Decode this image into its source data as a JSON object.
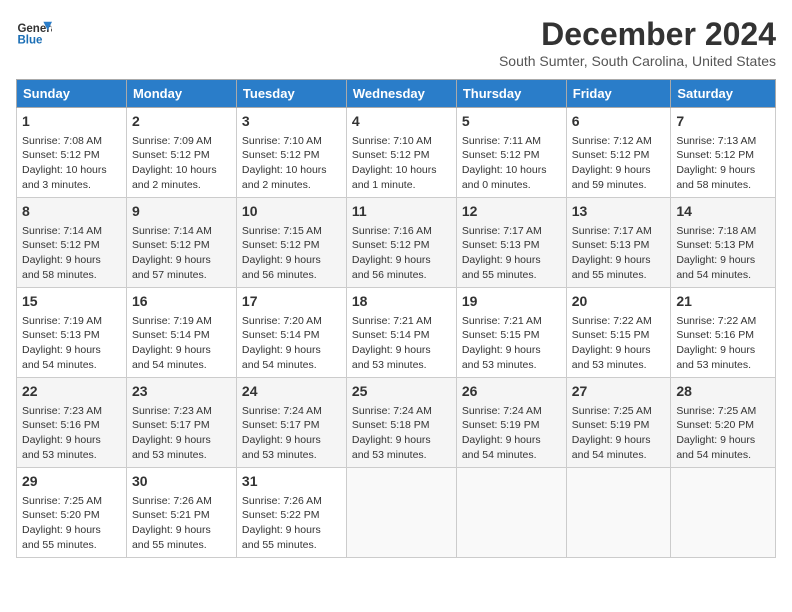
{
  "header": {
    "logo_line1": "General",
    "logo_line2": "Blue",
    "month_title": "December 2024",
    "location": "South Sumter, South Carolina, United States"
  },
  "days_of_week": [
    "Sunday",
    "Monday",
    "Tuesday",
    "Wednesday",
    "Thursday",
    "Friday",
    "Saturday"
  ],
  "weeks": [
    [
      {
        "day": "1",
        "lines": [
          "Sunrise: 7:08 AM",
          "Sunset: 5:12 PM",
          "Daylight: 10 hours",
          "and 3 minutes."
        ]
      },
      {
        "day": "2",
        "lines": [
          "Sunrise: 7:09 AM",
          "Sunset: 5:12 PM",
          "Daylight: 10 hours",
          "and 2 minutes."
        ]
      },
      {
        "day": "3",
        "lines": [
          "Sunrise: 7:10 AM",
          "Sunset: 5:12 PM",
          "Daylight: 10 hours",
          "and 2 minutes."
        ]
      },
      {
        "day": "4",
        "lines": [
          "Sunrise: 7:10 AM",
          "Sunset: 5:12 PM",
          "Daylight: 10 hours",
          "and 1 minute."
        ]
      },
      {
        "day": "5",
        "lines": [
          "Sunrise: 7:11 AM",
          "Sunset: 5:12 PM",
          "Daylight: 10 hours",
          "and 0 minutes."
        ]
      },
      {
        "day": "6",
        "lines": [
          "Sunrise: 7:12 AM",
          "Sunset: 5:12 PM",
          "Daylight: 9 hours",
          "and 59 minutes."
        ]
      },
      {
        "day": "7",
        "lines": [
          "Sunrise: 7:13 AM",
          "Sunset: 5:12 PM",
          "Daylight: 9 hours",
          "and 58 minutes."
        ]
      }
    ],
    [
      {
        "day": "8",
        "lines": [
          "Sunrise: 7:14 AM",
          "Sunset: 5:12 PM",
          "Daylight: 9 hours",
          "and 58 minutes."
        ]
      },
      {
        "day": "9",
        "lines": [
          "Sunrise: 7:14 AM",
          "Sunset: 5:12 PM",
          "Daylight: 9 hours",
          "and 57 minutes."
        ]
      },
      {
        "day": "10",
        "lines": [
          "Sunrise: 7:15 AM",
          "Sunset: 5:12 PM",
          "Daylight: 9 hours",
          "and 56 minutes."
        ]
      },
      {
        "day": "11",
        "lines": [
          "Sunrise: 7:16 AM",
          "Sunset: 5:12 PM",
          "Daylight: 9 hours",
          "and 56 minutes."
        ]
      },
      {
        "day": "12",
        "lines": [
          "Sunrise: 7:17 AM",
          "Sunset: 5:13 PM",
          "Daylight: 9 hours",
          "and 55 minutes."
        ]
      },
      {
        "day": "13",
        "lines": [
          "Sunrise: 7:17 AM",
          "Sunset: 5:13 PM",
          "Daylight: 9 hours",
          "and 55 minutes."
        ]
      },
      {
        "day": "14",
        "lines": [
          "Sunrise: 7:18 AM",
          "Sunset: 5:13 PM",
          "Daylight: 9 hours",
          "and 54 minutes."
        ]
      }
    ],
    [
      {
        "day": "15",
        "lines": [
          "Sunrise: 7:19 AM",
          "Sunset: 5:13 PM",
          "Daylight: 9 hours",
          "and 54 minutes."
        ]
      },
      {
        "day": "16",
        "lines": [
          "Sunrise: 7:19 AM",
          "Sunset: 5:14 PM",
          "Daylight: 9 hours",
          "and 54 minutes."
        ]
      },
      {
        "day": "17",
        "lines": [
          "Sunrise: 7:20 AM",
          "Sunset: 5:14 PM",
          "Daylight: 9 hours",
          "and 54 minutes."
        ]
      },
      {
        "day": "18",
        "lines": [
          "Sunrise: 7:21 AM",
          "Sunset: 5:14 PM",
          "Daylight: 9 hours",
          "and 53 minutes."
        ]
      },
      {
        "day": "19",
        "lines": [
          "Sunrise: 7:21 AM",
          "Sunset: 5:15 PM",
          "Daylight: 9 hours",
          "and 53 minutes."
        ]
      },
      {
        "day": "20",
        "lines": [
          "Sunrise: 7:22 AM",
          "Sunset: 5:15 PM",
          "Daylight: 9 hours",
          "and 53 minutes."
        ]
      },
      {
        "day": "21",
        "lines": [
          "Sunrise: 7:22 AM",
          "Sunset: 5:16 PM",
          "Daylight: 9 hours",
          "and 53 minutes."
        ]
      }
    ],
    [
      {
        "day": "22",
        "lines": [
          "Sunrise: 7:23 AM",
          "Sunset: 5:16 PM",
          "Daylight: 9 hours",
          "and 53 minutes."
        ]
      },
      {
        "day": "23",
        "lines": [
          "Sunrise: 7:23 AM",
          "Sunset: 5:17 PM",
          "Daylight: 9 hours",
          "and 53 minutes."
        ]
      },
      {
        "day": "24",
        "lines": [
          "Sunrise: 7:24 AM",
          "Sunset: 5:17 PM",
          "Daylight: 9 hours",
          "and 53 minutes."
        ]
      },
      {
        "day": "25",
        "lines": [
          "Sunrise: 7:24 AM",
          "Sunset: 5:18 PM",
          "Daylight: 9 hours",
          "and 53 minutes."
        ]
      },
      {
        "day": "26",
        "lines": [
          "Sunrise: 7:24 AM",
          "Sunset: 5:19 PM",
          "Daylight: 9 hours",
          "and 54 minutes."
        ]
      },
      {
        "day": "27",
        "lines": [
          "Sunrise: 7:25 AM",
          "Sunset: 5:19 PM",
          "Daylight: 9 hours",
          "and 54 minutes."
        ]
      },
      {
        "day": "28",
        "lines": [
          "Sunrise: 7:25 AM",
          "Sunset: 5:20 PM",
          "Daylight: 9 hours",
          "and 54 minutes."
        ]
      }
    ],
    [
      {
        "day": "29",
        "lines": [
          "Sunrise: 7:25 AM",
          "Sunset: 5:20 PM",
          "Daylight: 9 hours",
          "and 55 minutes."
        ]
      },
      {
        "day": "30",
        "lines": [
          "Sunrise: 7:26 AM",
          "Sunset: 5:21 PM",
          "Daylight: 9 hours",
          "and 55 minutes."
        ]
      },
      {
        "day": "31",
        "lines": [
          "Sunrise: 7:26 AM",
          "Sunset: 5:22 PM",
          "Daylight: 9 hours",
          "and 55 minutes."
        ]
      },
      {
        "day": "",
        "lines": []
      },
      {
        "day": "",
        "lines": []
      },
      {
        "day": "",
        "lines": []
      },
      {
        "day": "",
        "lines": []
      }
    ]
  ]
}
